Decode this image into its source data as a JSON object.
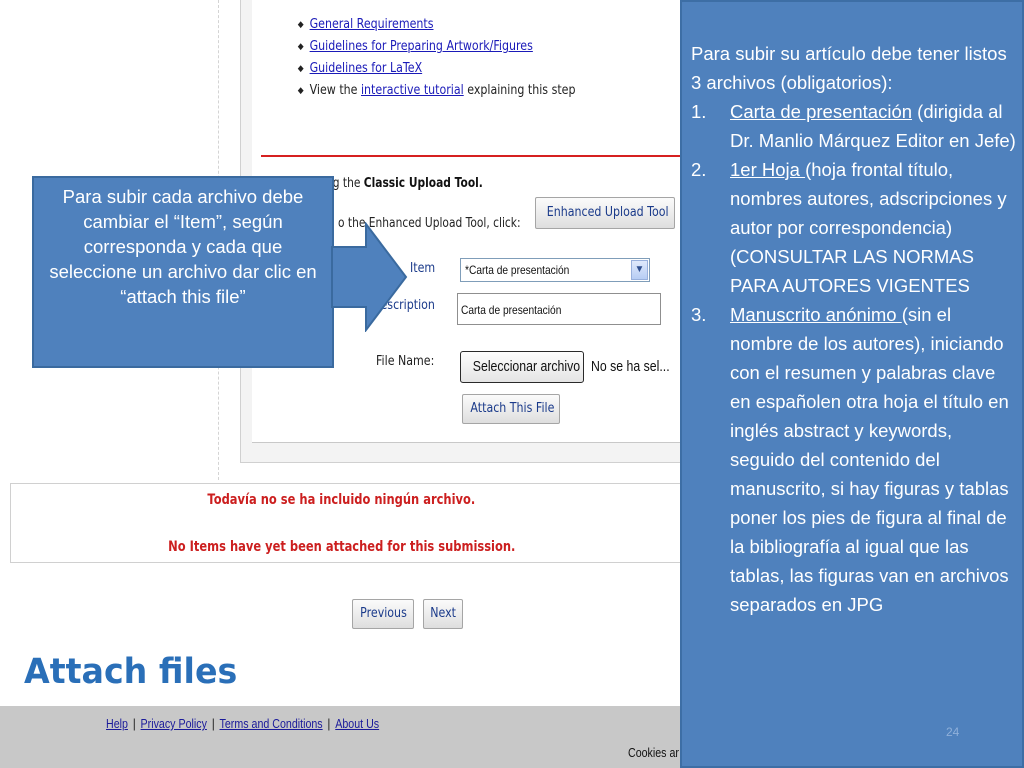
{
  "guidelines": {
    "items": [
      {
        "link": "General Requirements",
        "after": ""
      },
      {
        "link": "Guidelines for Preparing Artwork/Figures",
        "after": ""
      },
      {
        "link": "Guidelines for LaTeX",
        "after": ""
      },
      {
        "before": "View the ",
        "link": "interactive tutorial",
        "after": " explaining this step"
      }
    ]
  },
  "upload": {
    "classic_prefix": "ng the ",
    "classic_bold": "Classic Upload Tool.",
    "enhanced_text": "o the Enhanced Upload Tool, click:",
    "enhanced_button": "Enhanced Upload Tool",
    "item_label": "Item",
    "item_value": "*Carta de presentación",
    "description_label": "Description",
    "description_value": "Carta de presentación",
    "file_name_label": "File Name:",
    "select_file_button": "Seleccionar archivo",
    "file_status": "No se ha sel...",
    "attach_button": "Attach This File"
  },
  "messages": {
    "spanish": "Todavía no se ha incluido ningún archivo.",
    "english": "No Items have yet been attached for this submission."
  },
  "nav": {
    "previous": "Previous",
    "next": "Next"
  },
  "heading": "Attach files",
  "footer": {
    "help": "Help",
    "privacy": "Privacy Policy",
    "terms": "Terms and Conditions",
    "about": "About Us",
    "cookies": "Cookies ar"
  },
  "callout": {
    "text": "Para subir cada archivo debe cambiar el “Item”, según corresponda y cada que seleccione un archivo dar clic en  “attach this file”",
    "color": "#4f81bd"
  },
  "info": {
    "intro": "Para subir su artículo debe tener listos 3 archivos (obligatorios):",
    "items": [
      {
        "num": "1.",
        "title": "Carta de presentación",
        "text": " (dirigida al Dr. Manlio Márquez Editor en Jefe)"
      },
      {
        "num": "2.",
        "title": "1er Hoja ",
        "text": "(hoja frontal título, nombres autores, adscripciones y autor por correspondencia) (CONSULTAR LAS NORMAS PARA AUTORES VIGENTES"
      },
      {
        "num": "3.",
        "title": "Manuscrito anónimo ",
        "text": "(sin el nombre de los autores), iniciando con el resumen y palabras clave en españolen otra hoja el título en inglés abstract y keywords, seguido del contenido del manuscrito, si hay figuras y tablas poner los pies de figura al final de la bibliografía al igual que las tablas, las figuras van en archivos separados en JPG"
      }
    ],
    "page_number": "24"
  },
  "colors": {
    "accent_blue": "#4f81bd",
    "heading_blue": "#2a6fb8",
    "error_red": "#cc1f1f",
    "link_blue": "#1a1ab8"
  }
}
